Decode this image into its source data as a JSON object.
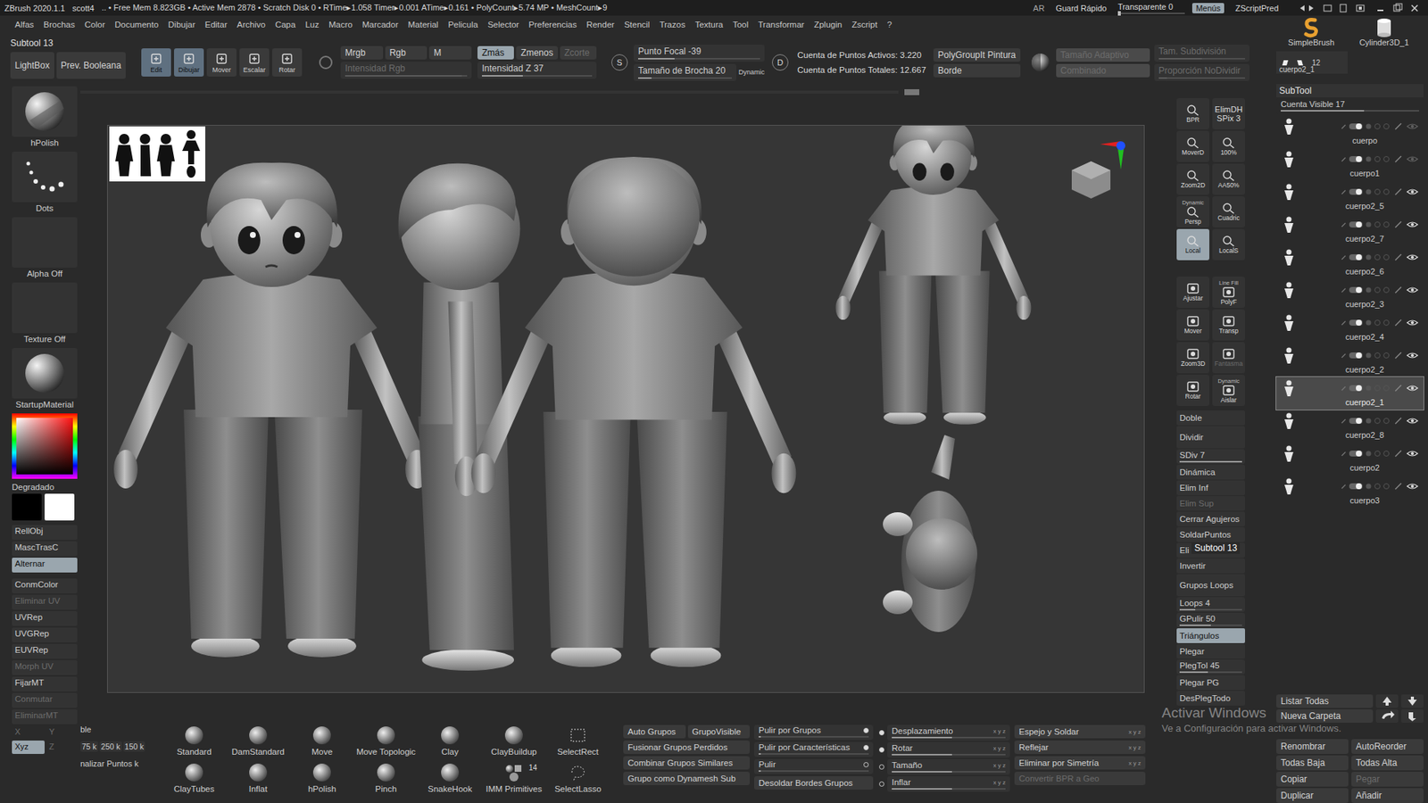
{
  "title_bar": {
    "app": "ZBrush 2020.1.1",
    "file": "scott4",
    "stats": ".. • Free Mem 8.823GB • Active Mem 2878 • Scratch Disk 0 • RTime▸1.058 Timer▸0.001 ATime▸0.161 • PolyCount▸5.74 MP • MeshCount▸9",
    "controls": [
      {
        "label": "AR",
        "kind": "text",
        "selected": false,
        "level": 0
      },
      {
        "label": "Guard Rápido",
        "kind": "button",
        "selected": false,
        "level": 0
      },
      {
        "label": "Transparente 0",
        "kind": "slider",
        "selected": false,
        "level": 0
      },
      {
        "label": "Menús",
        "kind": "button",
        "selected": true,
        "level": 0
      },
      {
        "label": "ZScriptPred",
        "kind": "button",
        "selected": false,
        "level": 0
      }
    ]
  },
  "menu": [
    "Alfas",
    "Brochas",
    "Color",
    "Documento",
    "Dibujar",
    "Editar",
    "Archivo",
    "Capa",
    "Luz",
    "Macro",
    "Marcador",
    "Material",
    "Pelicula",
    "Selector",
    "Preferencias",
    "Render",
    "Stencil",
    "Trazos",
    "Textura",
    "Tool",
    "Transformar",
    "Zplugin",
    "Zscript",
    "?"
  ],
  "top_shelf": {
    "title": "Subtool 13",
    "view_buttons": [
      "LightBox",
      "Prev. Booleana"
    ],
    "tools": [
      {
        "label": "Edit",
        "selected": true
      },
      {
        "label": "Dibujar",
        "selected": true
      },
      {
        "label": "Mover",
        "selected": false
      },
      {
        "label": "Escalar",
        "selected": false
      },
      {
        "label": "Rotar",
        "selected": false
      }
    ],
    "color_modes": [
      {
        "label": "Mrgb",
        "selected": false
      },
      {
        "label": "Rgb",
        "selected": false
      },
      {
        "label": "M",
        "selected": false
      }
    ],
    "rgb_intensity": {
      "label": "Intensidad Rgb",
      "level": 0.96,
      "disabled": true
    },
    "z_modes": [
      {
        "label": "Zmás",
        "selected": true,
        "disabled": false
      },
      {
        "label": "Zmenos",
        "selected": false,
        "disabled": false
      },
      {
        "label": "Zcorte",
        "selected": false,
        "disabled": true
      }
    ],
    "z_intensity": {
      "label": "Intensidad Z 37",
      "level": 0.37,
      "disabled": false
    },
    "focal_key": "S",
    "focal": {
      "label": "Punto Focal -39",
      "level": 0.3,
      "disabled": false
    },
    "brush_size": {
      "label": "Tamaño de Brocha 20",
      "level": 0.14,
      "disabled": false
    },
    "dynamic": "Dynamic",
    "size_key": "D",
    "counts": [
      "Cuenta de Puntos Activos: 3.220",
      "Cuenta de Puntos Totales: 12.667"
    ],
    "polygroup_buttons": [
      "PolyGroupIt Pintura",
      "Borde"
    ],
    "adaptive": [
      {
        "label": "Tamaño Adaptivo",
        "disabled": true
      },
      {
        "label": "Combinado",
        "disabled": true
      }
    ],
    "subdiv_sliders": [
      {
        "label": "Tam. Subdivisión",
        "level": 0.5,
        "disabled": true
      },
      {
        "label": "Proporción NoDividir",
        "level": 0.1,
        "disabled": true
      }
    ]
  },
  "left_shelf": {
    "tiles": [
      {
        "label": "hPolish",
        "kind": "brush"
      },
      {
        "label": "Dots",
        "kind": "stroke"
      },
      {
        "label": "Alpha Off",
        "kind": "empty"
      },
      {
        "label": "Texture Off",
        "kind": "empty"
      },
      {
        "label": "StartupMaterial",
        "kind": "material"
      }
    ],
    "gradient": "Degradado",
    "swatches": [
      {
        "color": "#000000"
      },
      {
        "color": "#ffffff"
      }
    ],
    "buttons": [
      {
        "label": "RellObj",
        "selected": false,
        "disabled": false
      },
      {
        "label": "MascTrasC",
        "selected": false,
        "disabled": false
      },
      {
        "label": "Alternar",
        "selected": true,
        "disabled": false
      }
    ],
    "uv_buttons": [
      {
        "label": "ConmColor",
        "selected": false,
        "disabled": false
      },
      {
        "label": "Eliminar UV",
        "selected": false,
        "disabled": true
      },
      {
        "label": "UVRep",
        "selected": false,
        "disabled": false
      },
      {
        "label": "UVGRep",
        "selected": false,
        "disabled": false
      },
      {
        "label": "EUVRep",
        "selected": false,
        "disabled": false
      },
      {
        "label": "Morph UV",
        "selected": false,
        "disabled": true
      },
      {
        "label": "FijarMT",
        "selected": false,
        "disabled": false
      },
      {
        "label": "Conmutar",
        "selected": false,
        "disabled": true
      },
      {
        "label": "EliminarMT",
        "selected": false,
        "disabled": true
      }
    ],
    "axes": [
      {
        "label": "X",
        "selected": false,
        "disabled": true
      },
      {
        "label": "Y",
        "selected": false,
        "disabled": true
      },
      {
        "label": "Xyz",
        "selected": true,
        "disabled": false
      },
      {
        "label": "Z",
        "selected": false,
        "disabled": true
      }
    ]
  },
  "right_shelf": {
    "icon_buttons_a": [
      {
        "label": "BPR",
        "top": "",
        "sub": "",
        "selected": false,
        "disabled": false
      },
      {
        "label": "ElimDH",
        "top": "",
        "sub": "SPix 3",
        "selected": false,
        "disabled": false
      },
      {
        "label": "MoverD",
        "top": "",
        "sub": "",
        "selected": false,
        "disabled": false
      },
      {
        "label": "100%",
        "top": "",
        "sub": "",
        "selected": false,
        "disabled": false
      },
      {
        "label": "Zoom2D",
        "top": "",
        "sub": "",
        "selected": false,
        "disabled": false
      },
      {
        "label": "AA50%",
        "top": "",
        "sub": "",
        "selected": false,
        "disabled": false
      },
      {
        "label": "Persp",
        "top": "Dynamic",
        "sub": "",
        "selected": false,
        "disabled": false
      },
      {
        "label": "Cuadric",
        "top": "",
        "sub": "",
        "selected": false,
        "disabled": false
      },
      {
        "label": "Local",
        "top": "",
        "sub": "",
        "selected": true,
        "disabled": false
      },
      {
        "label": "LocalS",
        "top": "",
        "sub": "",
        "selected": false,
        "disabled": false
      }
    ],
    "icon_buttons_b": [
      {
        "label": "Ajustar",
        "top": "",
        "sub": "",
        "selected": false,
        "disabled": false
      },
      {
        "label": "PolyF",
        "top": "Line Fill",
        "sub": "",
        "selected": false,
        "disabled": false
      },
      {
        "label": "Mover",
        "top": "",
        "sub": "",
        "selected": false,
        "disabled": false
      },
      {
        "label": "Transp",
        "top": "",
        "sub": "",
        "selected": false,
        "disabled": false
      },
      {
        "label": "Zoom3D",
        "top": "",
        "sub": "",
        "selected": false,
        "disabled": false
      },
      {
        "label": "Fantasma",
        "top": "",
        "sub": "",
        "selected": false,
        "disabled": true
      },
      {
        "label": "Rotar",
        "top": "",
        "sub": "",
        "selected": false,
        "disabled": false
      },
      {
        "label": "Aislar",
        "top": "Dynamic",
        "sub": "",
        "selected": false,
        "disabled": false
      }
    ],
    "tools": [
      {
        "label": "Doble",
        "kind": "button",
        "level": 0,
        "selected": false,
        "disabled": false
      },
      {
        "label": "Dividir",
        "kind": "tall",
        "level": 0,
        "selected": false,
        "disabled": false
      },
      {
        "label": "SDiv 7",
        "kind": "slider",
        "level": 1,
        "selected": false,
        "disabled": false
      },
      {
        "label": "Dinámica",
        "kind": "button",
        "level": 0,
        "selected": false,
        "disabled": false
      },
      {
        "label": "Elim Inf",
        "kind": "button",
        "level": 0,
        "selected": false,
        "disabled": false
      },
      {
        "label": "Elim Sup",
        "kind": "button",
        "level": 0,
        "selected": false,
        "disabled": true
      },
      {
        "label": "Cerrar Agujeros",
        "kind": "button",
        "level": 0,
        "selected": false,
        "disabled": false
      },
      {
        "label": "SoldarPuntos",
        "kind": "button",
        "level": 0,
        "selected": false,
        "disabled": false
      },
      {
        "label": "Eli",
        "kind": "button",
        "level": 0,
        "selected": false,
        "disabled": false,
        "tooltip": "Subtool 13"
      },
      {
        "label": "Invertir",
        "kind": "button",
        "level": 0,
        "selected": false,
        "disabled": false
      },
      {
        "label": "Grupos Loops",
        "kind": "tall",
        "level": 0,
        "selected": false,
        "disabled": false
      },
      {
        "label": "Loops 4",
        "kind": "slider",
        "level": 0.25,
        "selected": false,
        "disabled": false
      },
      {
        "label": "GPulir 50",
        "kind": "slider",
        "level": 0.5,
        "selected": false,
        "disabled": false
      },
      {
        "label": "Triángulos",
        "kind": "button",
        "level": 0,
        "selected": true,
        "disabled": false
      },
      {
        "label": "Plegar",
        "kind": "button",
        "level": 0,
        "selected": false,
        "disabled": false
      },
      {
        "label": "PlegTol 45",
        "kind": "slider",
        "level": 0.45,
        "selected": false,
        "disabled": false
      },
      {
        "label": "Plegar PG",
        "kind": "button",
        "level": 0,
        "selected": false,
        "disabled": false
      },
      {
        "label": "DesPlegTodo",
        "kind": "button",
        "level": 0,
        "selected": false,
        "disabled": false
      }
    ]
  },
  "bottom_shelf": {
    "mesh": {
      "top": "ble",
      "sizes": [
        "75 k",
        "250 k",
        "150 k"
      ],
      "bottom": "nalizar Puntos k"
    },
    "brushes": [
      {
        "label": "Standard",
        "kind": "sculpt",
        "badge": ""
      },
      {
        "label": "DamStandard",
        "kind": "sculpt",
        "badge": ""
      },
      {
        "label": "Move",
        "kind": "sculpt",
        "badge": ""
      },
      {
        "label": "Move Topologic",
        "kind": "sculpt",
        "badge": ""
      },
      {
        "label": "Clay",
        "kind": "sculpt",
        "badge": ""
      },
      {
        "label": "ClayBuildup",
        "kind": "sculpt",
        "badge": ""
      },
      {
        "label": "SelectRect",
        "kind": "rect",
        "badge": ""
      },
      {
        "label": "ClayTubes",
        "kind": "sculpt",
        "badge": ""
      },
      {
        "label": "Inflat",
        "kind": "sculpt",
        "badge": ""
      },
      {
        "label": "hPolish",
        "kind": "sculpt",
        "badge": ""
      },
      {
        "label": "Pinch",
        "kind": "sculpt",
        "badge": ""
      },
      {
        "label": "SnakeHook",
        "kind": "sculpt",
        "badge": ""
      },
      {
        "label": "IMM Primitives",
        "kind": "imm",
        "badge": "14"
      },
      {
        "label": "SelectLasso",
        "kind": "lasso",
        "badge": ""
      }
    ],
    "group_buttons": [
      "Auto Grupos",
      "GrupoVisible",
      "Fusionar Grupos Perdidos",
      "Combinar Grupos Similares",
      "Grupo como Dynamesh Sub"
    ],
    "polish": [
      {
        "label": "Pulir por Grupos",
        "kind": "slider",
        "level": 0.02,
        "on": true
      },
      {
        "label": "Pulir por Características",
        "kind": "slider",
        "level": 0.02,
        "on": true
      },
      {
        "label": "Pulir",
        "kind": "slider",
        "level": 0.02,
        "on": false
      },
      {
        "label": "Desoldar Bordes Grupos",
        "kind": "button",
        "level": 0,
        "on": false
      }
    ],
    "deform": [
      {
        "label": "Desplazamiento",
        "level": 0.53,
        "axes": "x y z",
        "on": true
      },
      {
        "label": "Rotar",
        "level": 0.53,
        "axes": "x y z",
        "on": true
      },
      {
        "label": "Tamaño",
        "level": 0.53,
        "axes": "x y z",
        "on": false
      },
      {
        "label": "Inflar",
        "level": 0.53,
        "axes": "x y z",
        "on": false
      }
    ],
    "symmetry": [
      {
        "label": "Espejo y Soldar",
        "axes": "x y z",
        "disabled": false
      },
      {
        "label": "Reflejar",
        "axes": "x y z",
        "disabled": false
      },
      {
        "label": "Eliminar por Simetría",
        "axes": "x y z",
        "disabled": false
      },
      {
        "label": "Convertir BPR a Geo",
        "axes": "",
        "disabled": true
      }
    ]
  },
  "tool_panel": {
    "thumbs": [
      {
        "label": "SimpleBrush",
        "kind": "brush"
      },
      {
        "label": "Cylinder3D_1",
        "kind": "cylinder"
      }
    ],
    "current": {
      "label": "cuerpo2_1",
      "count": "12"
    },
    "subtool": {
      "title": "SubTool",
      "visible_count": {
        "label": "Cuenta Visible 17",
        "level": 0.6
      },
      "items": [
        {
          "name": "cuerpo",
          "visible": false,
          "selected": false
        },
        {
          "name": "cuerpo1",
          "visible": false,
          "selected": false
        },
        {
          "name": "cuerpo2_5",
          "visible": true,
          "selected": false
        },
        {
          "name": "cuerpo2_7",
          "visible": true,
          "selected": false
        },
        {
          "name": "cuerpo2_6",
          "visible": true,
          "selected": false
        },
        {
          "name": "cuerpo2_3",
          "visible": true,
          "selected": false
        },
        {
          "name": "cuerpo2_4",
          "visible": true,
          "selected": false
        },
        {
          "name": "cuerpo2_2",
          "visible": true,
          "selected": false
        },
        {
          "name": "cuerpo2_1",
          "visible": true,
          "selected": true
        },
        {
          "name": "cuerpo2_8",
          "visible": true,
          "selected": false
        },
        {
          "name": "cuerpo2",
          "visible": true,
          "selected": false
        },
        {
          "name": "cuerpo3",
          "visible": true,
          "selected": false
        }
      ]
    },
    "actions_a": [
      "Listar Todas",
      "Nueva Carpeta"
    ],
    "actions_b": [
      {
        "label": "Renombrar",
        "disabled": false
      },
      {
        "label": "AutoReorder",
        "disabled": false
      },
      {
        "label": "Todas Baja",
        "disabled": false
      },
      {
        "label": "Todas Alta",
        "disabled": false
      },
      {
        "label": "Copiar",
        "disabled": false
      },
      {
        "label": "Pegar",
        "disabled": true
      },
      {
        "label": "Duplicar",
        "disabled": false
      },
      {
        "label": "Añadir",
        "disabled": false
      }
    ]
  },
  "watermark": {
    "line1": "Activar Windows",
    "line2": "Ve a Configuración para activar Windows."
  }
}
